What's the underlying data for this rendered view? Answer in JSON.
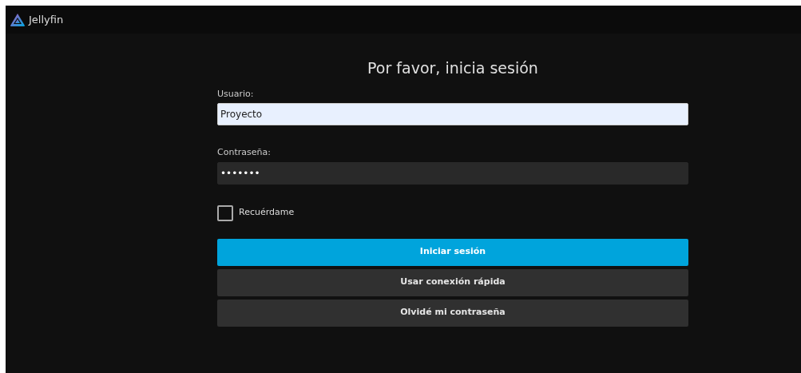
{
  "header": {
    "brand": "Jellyfin"
  },
  "form": {
    "title": "Por favor, inicia sesión",
    "fields": [
      {
        "label": "Usuario:",
        "value": "Proyecto",
        "kind": "autofilled"
      },
      {
        "label": "Contraseña:",
        "value": "•••••••",
        "kind": "password"
      }
    ],
    "remember": {
      "label": "Recuérdame",
      "checked": false
    },
    "buttons": [
      {
        "label": "Iniciar sesión",
        "kind": "primary"
      },
      {
        "label": "Usar conexión rápida",
        "kind": "secondary"
      },
      {
        "label": "Olvidé mi contraseña",
        "kind": "secondary"
      }
    ]
  }
}
